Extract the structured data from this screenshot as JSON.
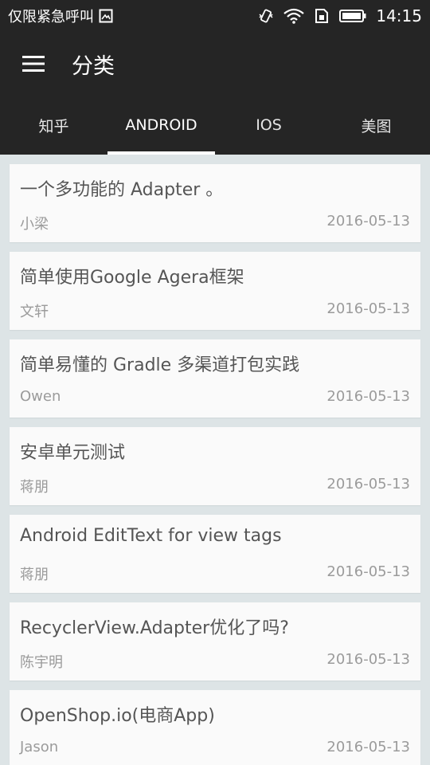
{
  "status_bar": {
    "carrier": "仅限紧急呼叫",
    "time": "14:15",
    "icons": [
      "image-icon",
      "vibrate-icon",
      "wifi-icon",
      "sim-icon",
      "battery-icon"
    ]
  },
  "app_bar": {
    "menu_icon": "menu-icon",
    "title": "分类"
  },
  "tabs": [
    {
      "label": "知乎",
      "active": false
    },
    {
      "label": "ANDROID",
      "active": true
    },
    {
      "label": "IOS",
      "active": false
    },
    {
      "label": "美图",
      "active": false
    }
  ],
  "articles": [
    {
      "title": "一个多功能的 Adapter 。",
      "author": "小梁",
      "date": "2016-05-13"
    },
    {
      "title": "简单使用Google Agera框架",
      "author": "文轩",
      "date": "2016-05-13"
    },
    {
      "title": "简单易懂的 Gradle 多渠道打包实践",
      "author": "Owen",
      "date": "2016-05-13"
    },
    {
      "title": "安卓单元测试",
      "author": "蒋朋",
      "date": "2016-05-13"
    },
    {
      "title": "Android EditText for view tags",
      "author": "蒋朋",
      "date": "2016-05-13"
    },
    {
      "title": "RecyclerView.Adapter优化了吗?",
      "author": "陈宇明",
      "date": "2016-05-13"
    },
    {
      "title": "OpenShop.io(电商App)",
      "author": "Jason",
      "date": "2016-05-13"
    }
  ],
  "colors": {
    "toolbar_bg": "#252525",
    "list_bg": "#dde4e6",
    "card_bg": "#fafafa",
    "title_text": "#555555",
    "meta_text": "#9b9b9b"
  }
}
